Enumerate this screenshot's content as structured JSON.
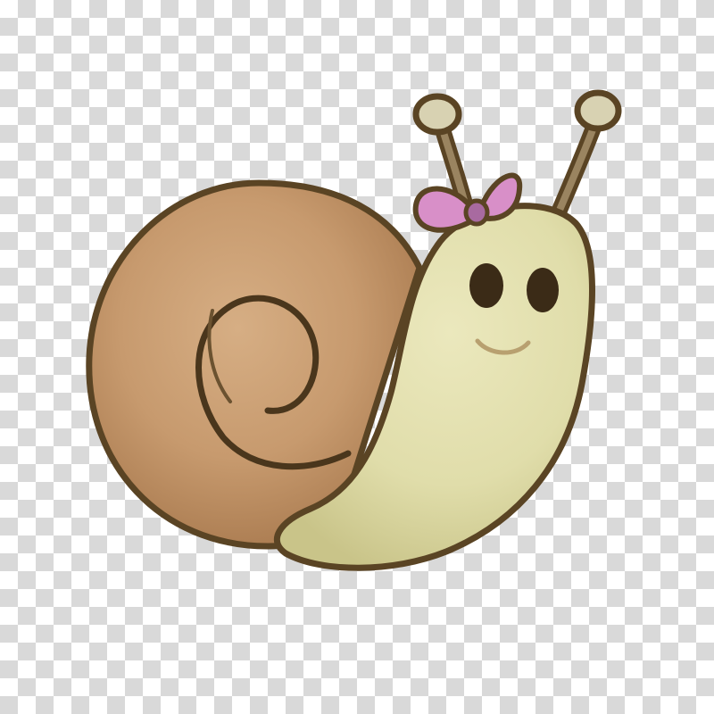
{
  "background": {
    "pattern": "transparency-checkerboard",
    "light_color": "#ffffff",
    "dark_color": "#d9d9d9"
  },
  "illustration": {
    "subject": "cartoon snail",
    "colors": {
      "outline": "#5a4424",
      "shell": "#c79a6e",
      "shell_shade": "#a8794e",
      "body": "#e0ddaa",
      "body_shade": "#c9c489",
      "bow": "#d88fc8",
      "bow_center": "#a86aa0",
      "eyes": "#3b2b17",
      "antenna_tip": "#d8d2b2"
    },
    "icons": [
      "snail-shell-icon",
      "snail-body-icon",
      "bow-icon",
      "antenna-icon",
      "eye-icon"
    ]
  }
}
